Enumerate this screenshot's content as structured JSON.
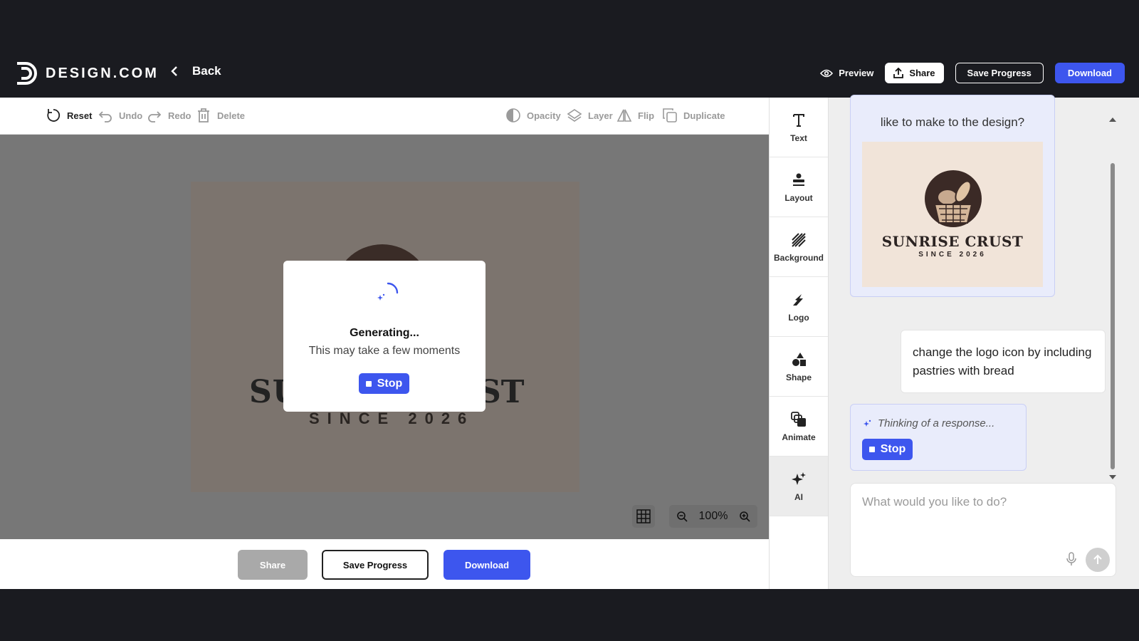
{
  "header": {
    "brand_text": "DESIGN.COM",
    "back_label": "Back",
    "preview_label": "Preview",
    "share_label": "Share",
    "save_label": "Save Progress",
    "download_label": "Download"
  },
  "toolbar": {
    "reset": "Reset",
    "undo": "Undo",
    "redo": "Redo",
    "delete": "Delete",
    "opacity": "Opacity",
    "layer": "Layer",
    "flip": "Flip",
    "duplicate": "Duplicate"
  },
  "canvas": {
    "art_title_left": "SU",
    "art_title_right": "ST",
    "art_subtitle": "SINCE 2026",
    "zoom": "100%"
  },
  "modal": {
    "title": "Generating...",
    "subtitle": "This may take a few moments",
    "stop_label": "Stop"
  },
  "bottombar": {
    "share_label": "Share",
    "save_label": "Save Progress",
    "download_label": "Download"
  },
  "sidetools": {
    "items": [
      {
        "label": "Text",
        "icon": "text-icon"
      },
      {
        "label": "Layout",
        "icon": "layout-icon"
      },
      {
        "label": "Background",
        "icon": "background-icon"
      },
      {
        "label": "Logo",
        "icon": "logo-icon"
      },
      {
        "label": "Shape",
        "icon": "shape-icon"
      },
      {
        "label": "Animate",
        "icon": "animate-icon"
      },
      {
        "label": "AI",
        "icon": "ai-sparkle-icon"
      }
    ],
    "active": "AI"
  },
  "chat": {
    "ai_message_tail": "like to make to the design?",
    "thumb_title": "SUNRISE CRUST",
    "thumb_subtitle": "SINCE 2026",
    "user_message": "change the logo icon by including pastries with bread",
    "thinking_text": "Thinking of a response...",
    "thinking_stop_label": "Stop",
    "input_placeholder": "What would you like to do?"
  },
  "colors": {
    "accent": "#3d56ee",
    "header_bg": "#1a1b20",
    "canvas_bg": "#777777",
    "chat_bubble_ai": "#e9ecfb"
  }
}
